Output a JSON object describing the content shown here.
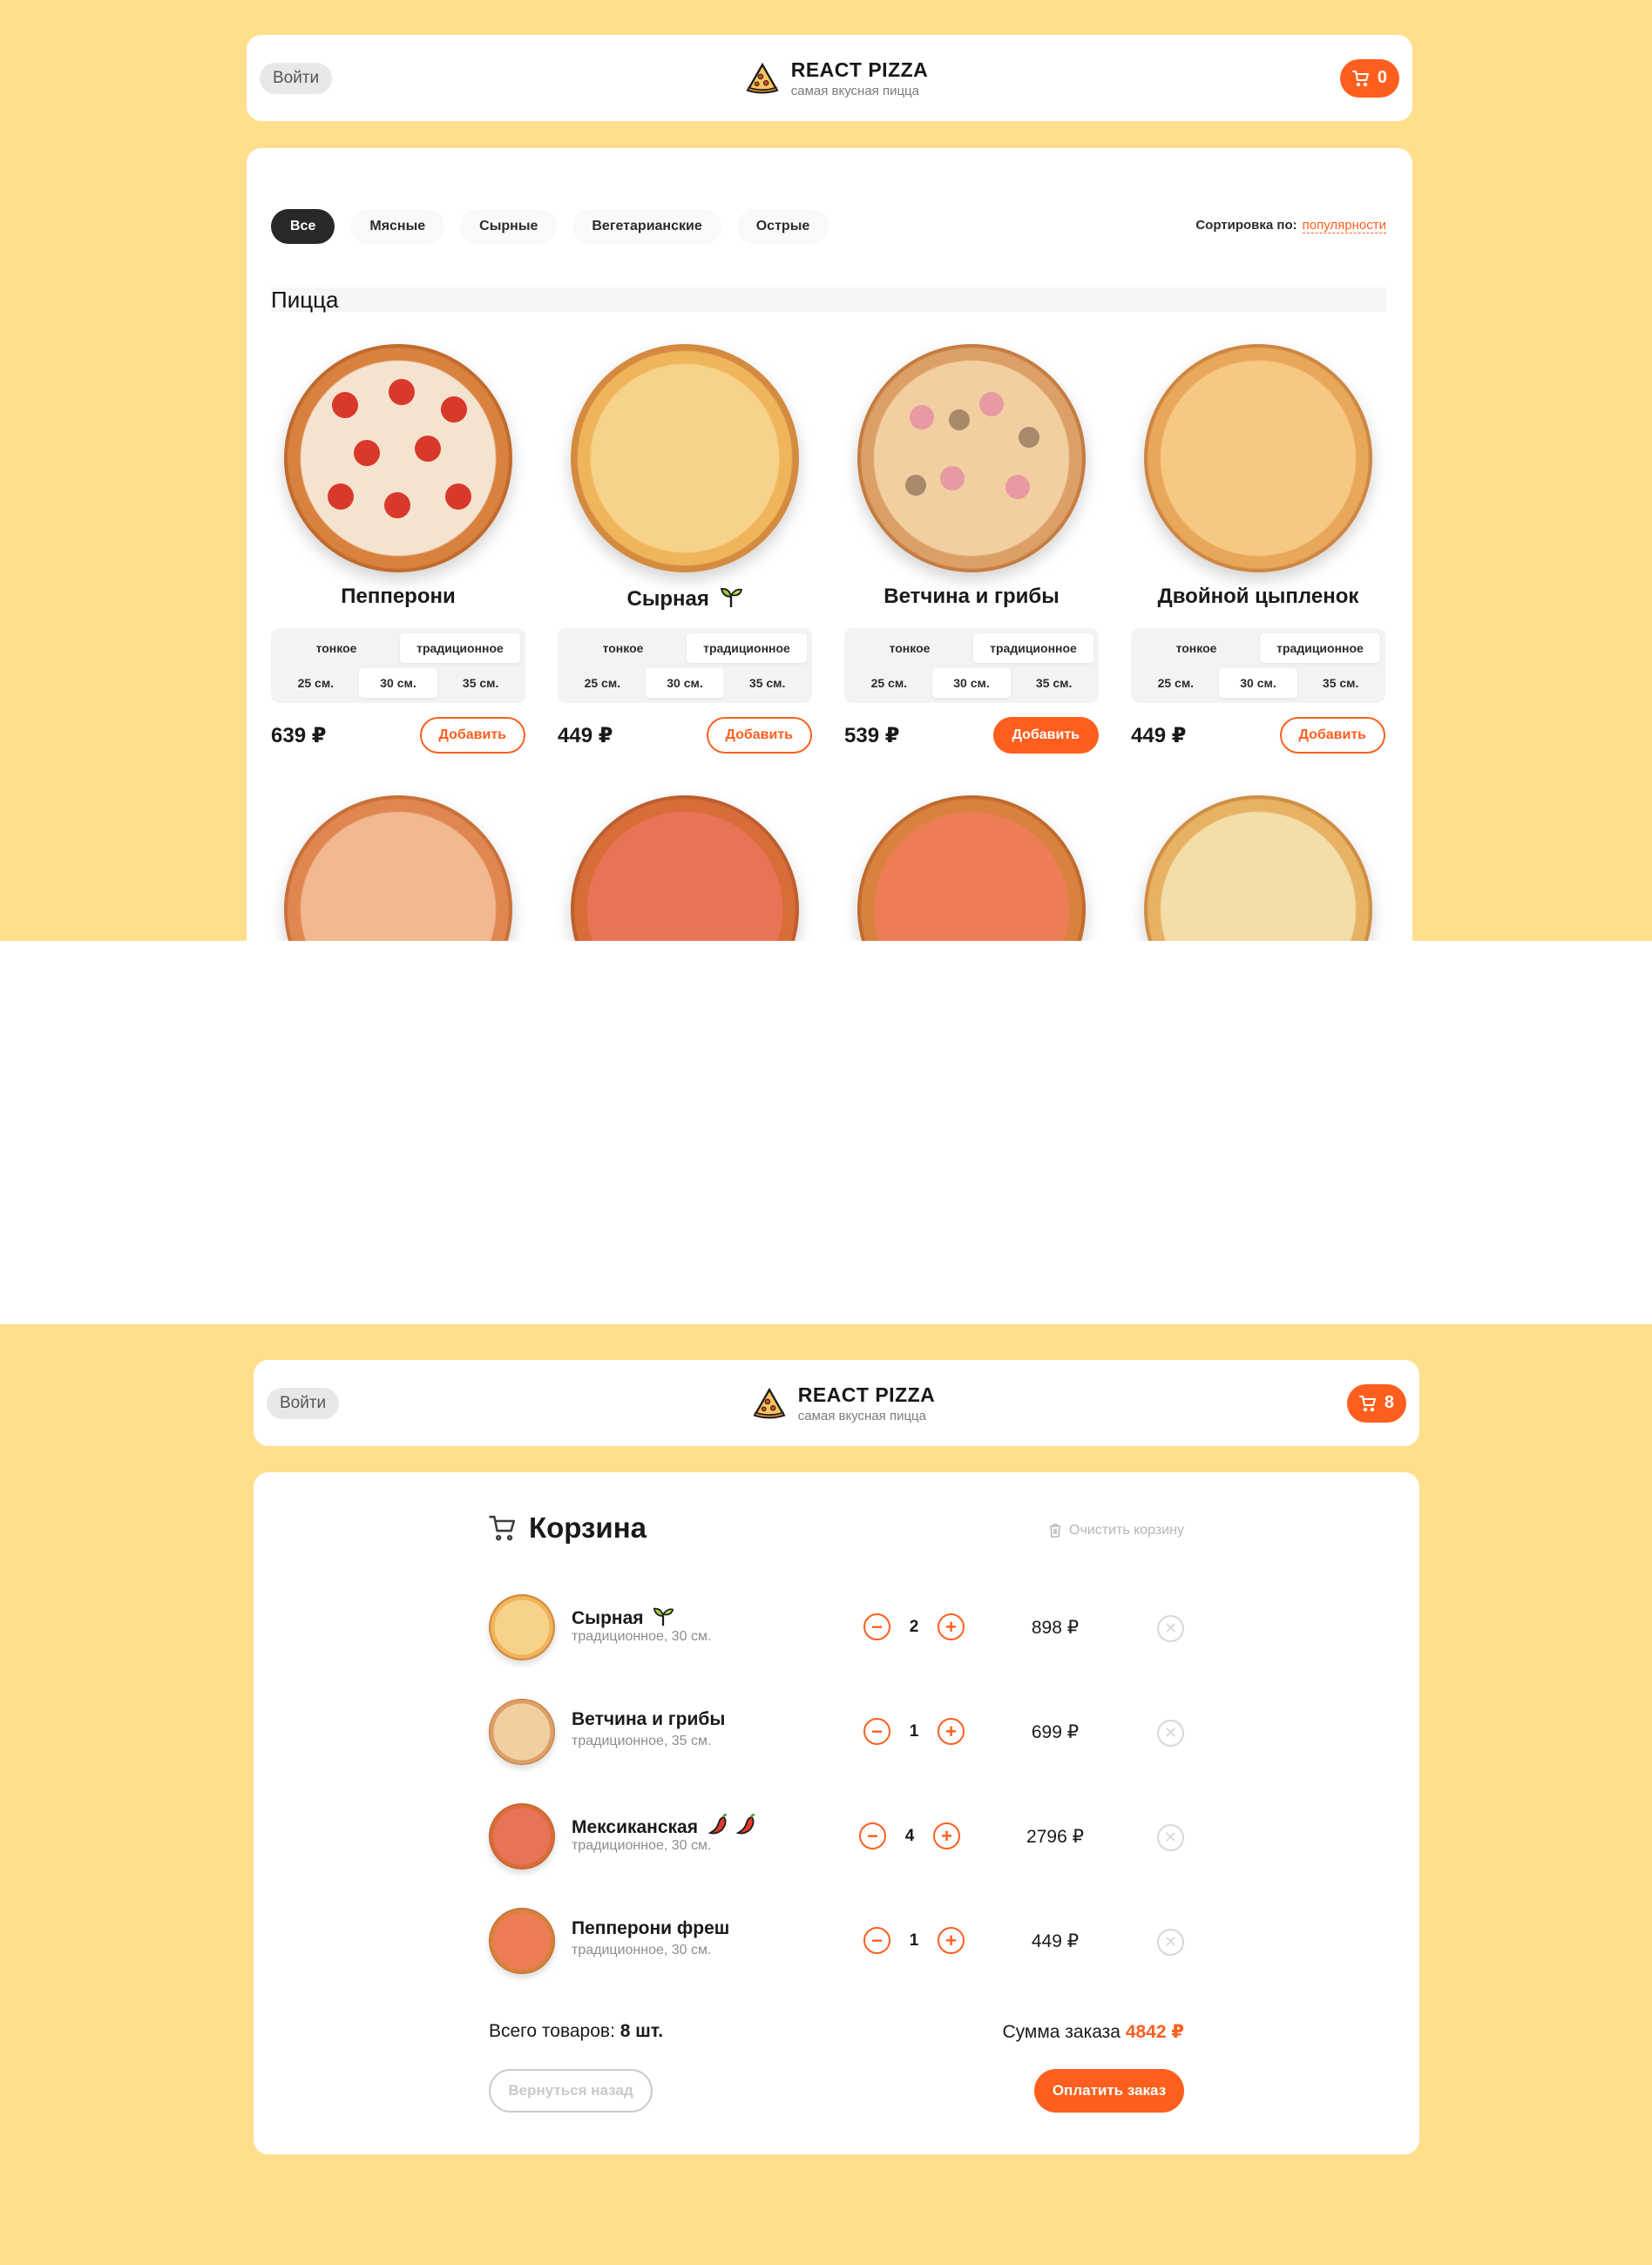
{
  "header_top": {
    "login_label": "Войти",
    "brand_title": "REACT PIZZA",
    "brand_subtitle": "самая вкусная пицца",
    "cart_count": "0"
  },
  "categories": [
    "Все",
    "Мясные",
    "Сырные",
    "Вегетарианские",
    "Острые"
  ],
  "active_category": "Все",
  "sort": {
    "label": "Сортировка по:",
    "value": "популярности"
  },
  "section_title": "Пицца",
  "dough_options": [
    "тонкое",
    "традиционное"
  ],
  "size_options": [
    "25 см.",
    "30 см.",
    "35 см."
  ],
  "add_label": "Добавить",
  "pizzas": [
    {
      "name": "Пепперони",
      "price": "639 ₽",
      "dough_selected": "традиционное",
      "size_selected": "30 см.",
      "badge_icon": ""
    },
    {
      "name": "Сырная",
      "price": "449 ₽",
      "dough_selected": "традиционное",
      "size_selected": "30 см.",
      "badge_icon": "sprout-icon"
    },
    {
      "name": "Ветчина и грибы",
      "price": "539 ₽",
      "dough_selected": "традиционное",
      "size_selected": "30 см.",
      "badge_icon": ""
    },
    {
      "name": "Двойной цыпленок",
      "price": "449 ₽",
      "dough_selected": "традиционное",
      "size_selected": "30 см.",
      "badge_icon": ""
    }
  ],
  "header_bottom": {
    "login_label": "Войти",
    "brand_title": "REACT PIZZA",
    "brand_subtitle": "самая вкусная пицца",
    "cart_count": "8"
  },
  "cart": {
    "title": "Корзина",
    "clear_label": "Очистить корзину",
    "items": [
      {
        "name": "Сырная",
        "meta": "традиционное, 30 см.",
        "qty": "2",
        "price": "898 ₽",
        "badge": "sprout"
      },
      {
        "name": "Ветчина и грибы",
        "meta": "традиционное, 35 см.",
        "qty": "1",
        "price": "699 ₽",
        "badge": ""
      },
      {
        "name": "Мексиканская",
        "meta": "традиционное, 30 см.",
        "qty": "4",
        "price": "2796 ₽",
        "badge": "chili"
      },
      {
        "name": "Пепперони фреш",
        "meta": "традиционное, 30 см.",
        "qty": "1",
        "price": "449 ₽",
        "badge": ""
      }
    ],
    "total_items_label": "Всего товаров:",
    "total_items_value": "8 шт.",
    "sum_label": "Сумма заказа",
    "sum_value": "4842 ₽",
    "back_label": "Вернуться назад",
    "pay_label": "Оплатить заказ"
  },
  "colors": {
    "accent": "#fe5f1e",
    "background": "#ffdf8c",
    "dark": "#282828"
  }
}
